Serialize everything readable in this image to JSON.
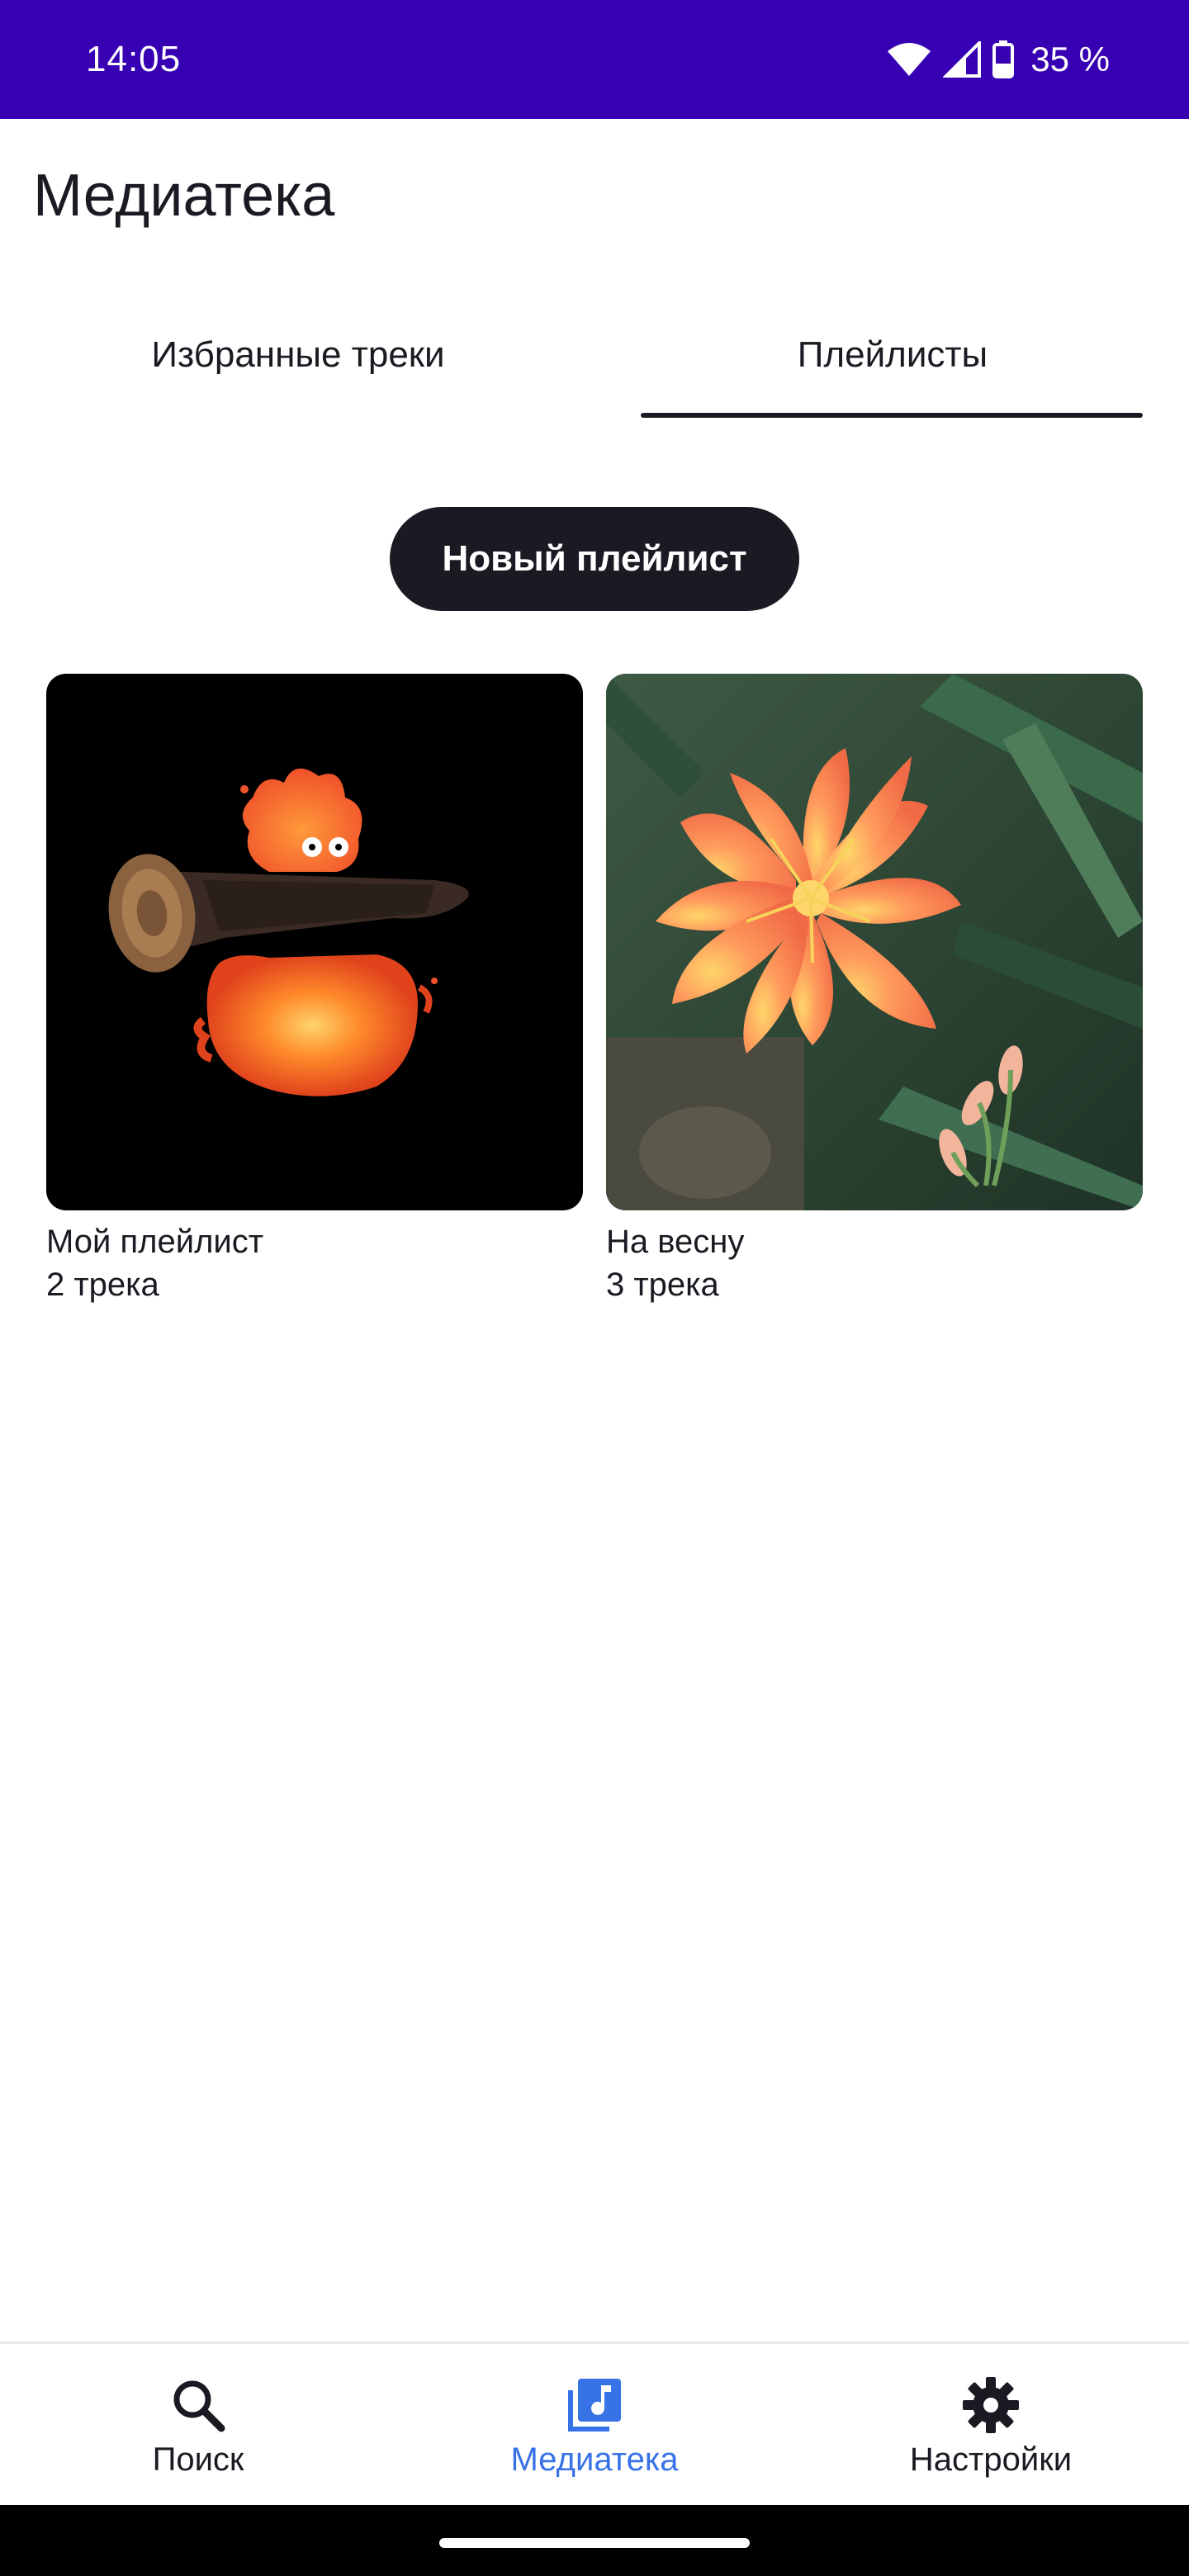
{
  "status_bar": {
    "time": "14:05",
    "battery": "35 %",
    "icons": [
      "wifi-icon",
      "signal-icon",
      "battery-icon"
    ]
  },
  "header": {
    "title": "Медиатека"
  },
  "tabs": [
    {
      "label": "Избранные треки",
      "active": false
    },
    {
      "label": "Плейлисты",
      "active": true
    }
  ],
  "new_playlist": {
    "label": "Новый плейлист"
  },
  "playlists": [
    {
      "title": "Мой плейлист",
      "count": "2 трека",
      "cover": "fire-spirit-illustration"
    },
    {
      "title": "На весну",
      "count": "3 трека",
      "cover": "orange-flowers-photo"
    }
  ],
  "bottom_nav": {
    "items": [
      {
        "label": "Поиск",
        "icon": "search-icon",
        "active": false
      },
      {
        "label": "Медиатека",
        "icon": "music-library-icon",
        "active": true
      },
      {
        "label": "Настройки",
        "icon": "gear-icon",
        "active": false
      }
    ]
  },
  "colors": {
    "status_bar": "#3700b3",
    "active_nav": "#3772e7",
    "text": "#1a1b22",
    "button_bg": "#1a1b22"
  }
}
